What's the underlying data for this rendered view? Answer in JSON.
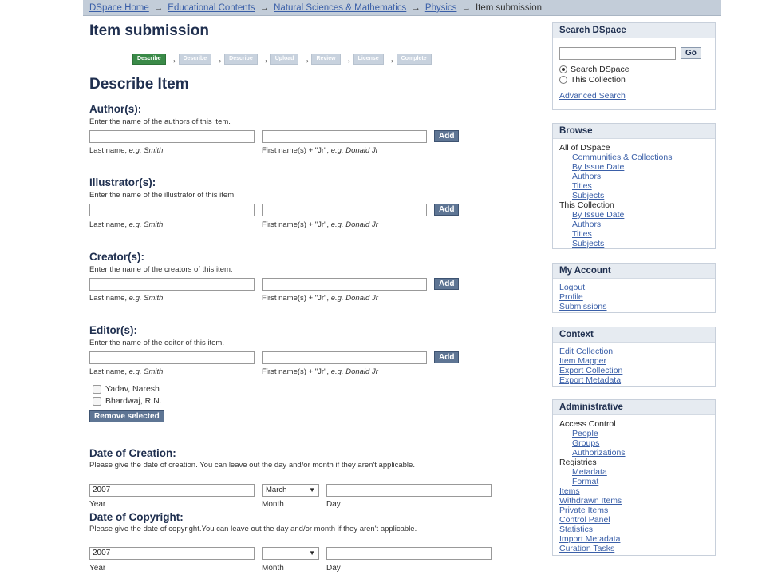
{
  "breadcrumb": {
    "items": [
      "DSpace Home",
      "Educational Contents",
      "Natural Sciences & Mathematics",
      "Physics"
    ],
    "current": "Item submission",
    "separator": "→"
  },
  "page_title": "Item submission",
  "progress": {
    "steps": [
      "Describe",
      "Describe",
      "Describe",
      "Upload",
      "Review",
      "License",
      "Complete"
    ],
    "active_index": 0
  },
  "section_title": "Describe Item",
  "name_fields": [
    {
      "label": "Author(s):",
      "hint": "Enter the name of the authors of this item.",
      "add_label": "Add"
    },
    {
      "label": "Illustrator(s):",
      "hint": "Enter the name of the illustrator of this item.",
      "add_label": "Add"
    },
    {
      "label": "Creator(s):",
      "hint": "Enter the name of the creators of this item.",
      "add_label": "Add"
    },
    {
      "label": "Editor(s):",
      "hint": "Enter the name of the editor of this item.",
      "add_label": "Add"
    }
  ],
  "name_sublabels": {
    "last": "Last name, ",
    "last_example": "e.g. Smith",
    "first": "First name(s) + \"Jr\", ",
    "first_example": "e.g. Donald Jr"
  },
  "editors": {
    "entries": [
      "Yadav, Naresh",
      "Bhardwaj, R.N."
    ],
    "remove_label": "Remove selected"
  },
  "date_creation": {
    "label": "Date of Creation:",
    "hint": "Please give the date of creation. You can leave out the day and/or month if they aren't applicable.",
    "year": "2007",
    "month": "March",
    "day": "",
    "year_label": "Year",
    "month_label": "Month",
    "day_label": "Day"
  },
  "date_copyright": {
    "label": "Date of Copyright:",
    "hint": "Please give the date of copyright.You can leave out the day and/or month if they aren't applicable.",
    "year": "2007",
    "month": "",
    "day": "",
    "year_label": "Year",
    "month_label": "Month",
    "day_label": "Day"
  },
  "sidebar": {
    "search": {
      "title": "Search DSpace",
      "go_label": "Go",
      "option_all": "Search DSpace",
      "option_collection": "This Collection",
      "selected": "all",
      "advanced": "Advanced Search"
    },
    "browse": {
      "title": "Browse",
      "all_label": "All of DSpace",
      "all_links": [
        "Communities & Collections",
        "By Issue Date",
        "Authors",
        "Titles",
        "Subjects"
      ],
      "collection_label": "This Collection",
      "collection_links": [
        "By Issue Date",
        "Authors",
        "Titles",
        "Subjects"
      ]
    },
    "account": {
      "title": "My Account",
      "links": [
        "Logout",
        "Profile",
        "Submissions"
      ]
    },
    "context": {
      "title": "Context",
      "links": [
        "Edit Collection",
        "Item Mapper",
        "Export Collection",
        "Export Metadata"
      ]
    },
    "admin": {
      "title": "Administrative",
      "access_label": "Access Control",
      "access_links": [
        "People",
        "Groups",
        "Authorizations"
      ],
      "registries_label": "Registries",
      "registries_links": [
        "Metadata",
        "Format"
      ],
      "links": [
        "Items",
        "Withdrawn Items",
        "Private Items",
        "Control Panel",
        "Statistics",
        "Import Metadata",
        "Curation Tasks"
      ]
    }
  },
  "colors": {
    "active_step": "#3a8a48",
    "button": "#5e7594",
    "link": "#3a5fa8",
    "breadcrumb_bar": "#c3cdd9"
  }
}
